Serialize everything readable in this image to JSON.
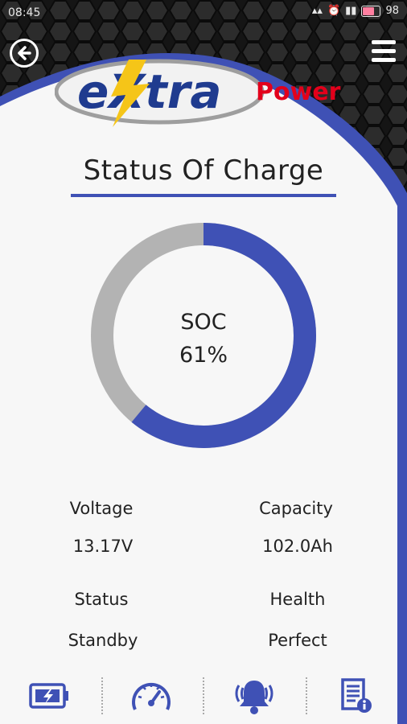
{
  "status_bar": {
    "time": "08:45",
    "battery_level": "98"
  },
  "brand": {
    "logo_text_extra": "eXtra",
    "logo_text_power": "Power"
  },
  "page": {
    "title": "Status Of Charge"
  },
  "gauge": {
    "label": "SOC",
    "value_text": "61%",
    "fraction": 0.61,
    "fill_color": "#3f51b5",
    "track_color": "#b3b3b3"
  },
  "stats": {
    "voltage": {
      "label": "Voltage",
      "value": "13.17V"
    },
    "capacity": {
      "label": "Capacity",
      "value": "102.0Ah"
    },
    "status": {
      "label": "Status",
      "value": "Standby"
    },
    "health": {
      "label": "Health",
      "value": "Perfect"
    }
  },
  "nav": {
    "items": [
      {
        "icon": "battery-icon"
      },
      {
        "icon": "speedometer-icon"
      },
      {
        "icon": "bell-icon"
      },
      {
        "icon": "info-document-icon"
      }
    ]
  },
  "colors": {
    "accent": "#3f51b5",
    "logo_yellow": "#f5c518",
    "logo_red": "#e3001b"
  }
}
